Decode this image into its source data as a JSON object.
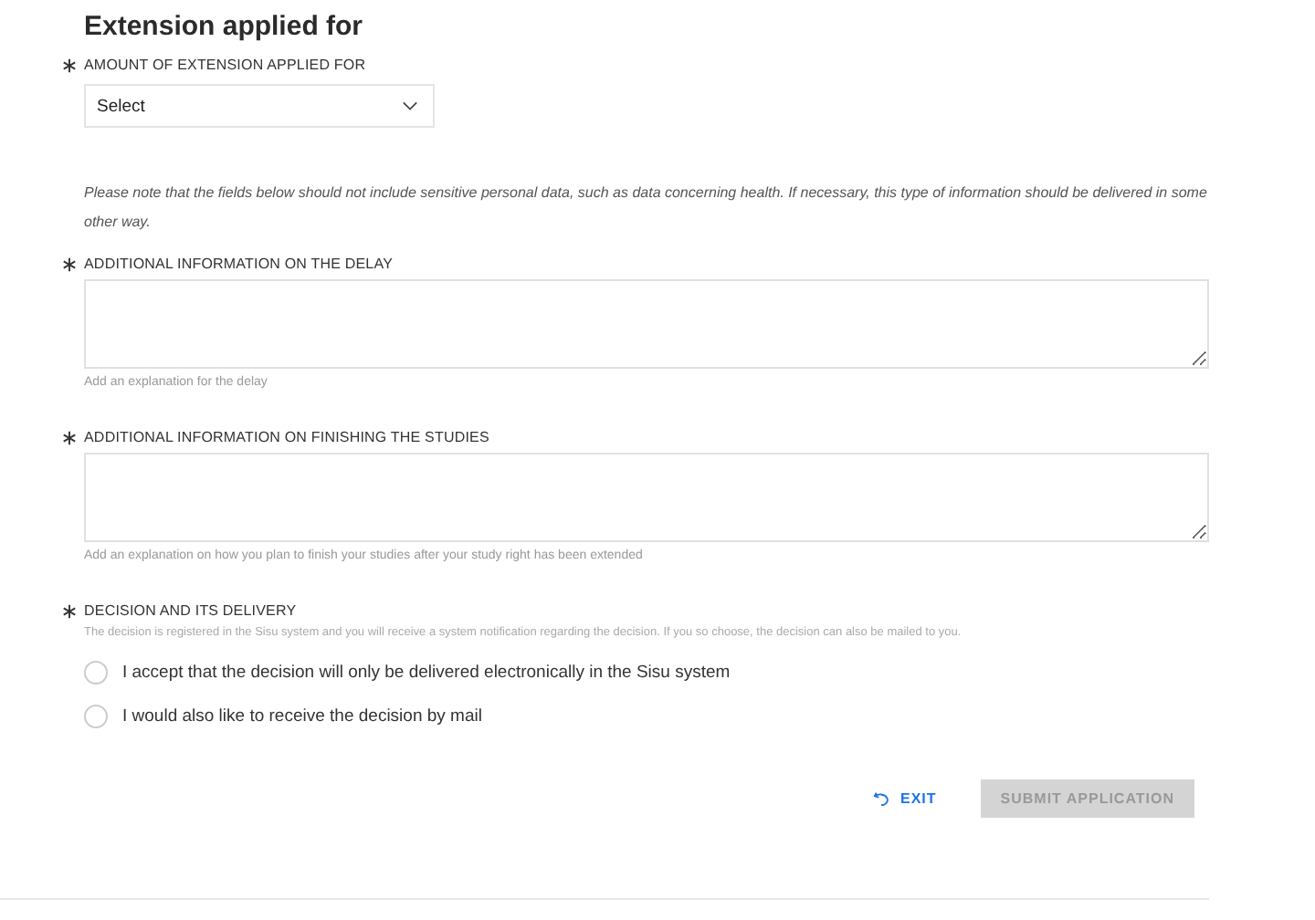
{
  "title": "Extension applied for",
  "amount": {
    "label": "AMOUNT OF EXTENSION APPLIED FOR",
    "required": true,
    "value": "Select"
  },
  "notice": "Please note that the fields below should not include sensitive personal data, such as data concerning health. If necessary, this type of information should be delivered in some other way.",
  "text_fields": [
    {
      "label": "ADDITIONAL INFORMATION ON THE DELAY",
      "required": true,
      "help": "Add an explanation for the delay"
    },
    {
      "label": "ADDITIONAL INFORMATION ON FINISHING THE STUDIES",
      "required": true,
      "help": "Add an explanation on how you plan to finish your studies after your study right has been extended"
    }
  ],
  "decision": {
    "label": "DECISION AND ITS DELIVERY",
    "required": true,
    "description": "The decision is registered in the Sisu system and you will receive a system notification regarding the decision. If you so choose, the decision can also be mailed to you.",
    "options": [
      {
        "label": "I accept that the decision will only be delivered electronically in the Sisu system",
        "selected": false
      },
      {
        "label": "I would also like to receive the decision by mail",
        "selected": false
      }
    ]
  },
  "buttons": {
    "exit": "EXIT",
    "submit": {
      "label": "SUBMIT APPLICATION",
      "disabled": true
    }
  }
}
